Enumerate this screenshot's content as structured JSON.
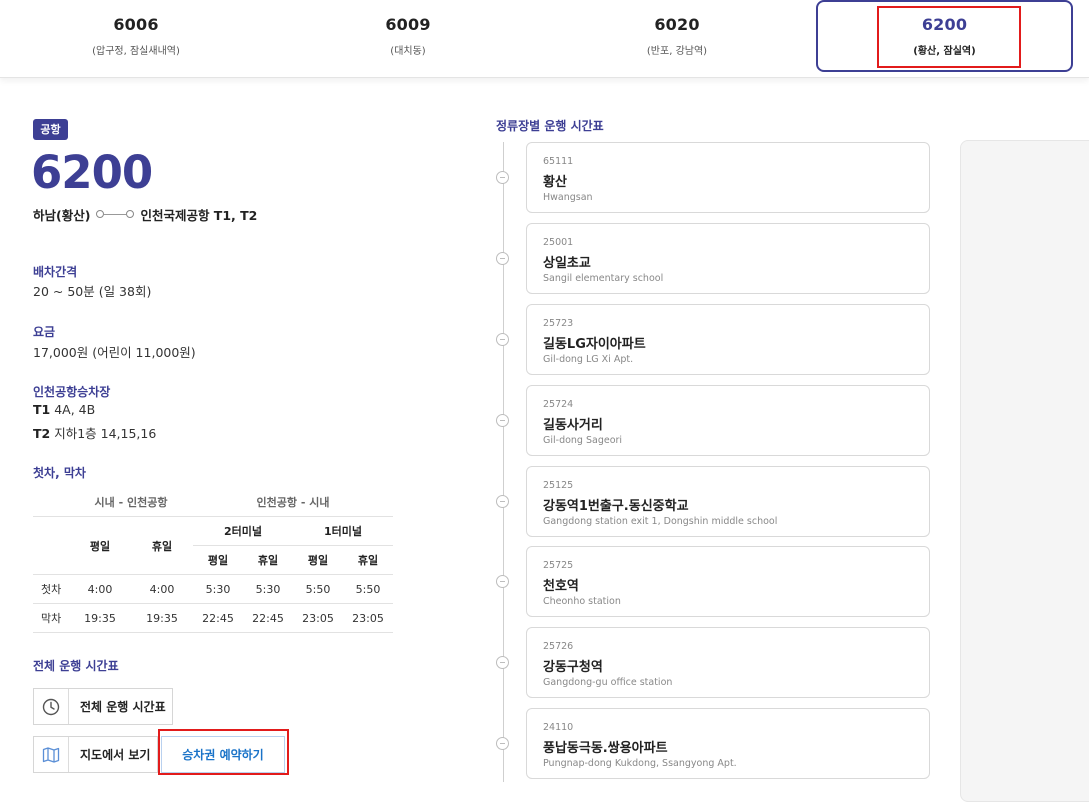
{
  "tabs": [
    {
      "number": "6006",
      "sub": "(압구정, 잠실새내역)"
    },
    {
      "number": "6009",
      "sub": "(대치동)"
    },
    {
      "number": "6020",
      "sub": "(반포, 강남역)"
    },
    {
      "number": "6200",
      "sub": "(황산, 잠실역)"
    }
  ],
  "route": {
    "badge": "공항",
    "number": "6200",
    "from": "하남(황산)",
    "to": "인천국제공항 T1, T2"
  },
  "interval": {
    "title": "배차간격",
    "value": "20 ~ 50분 (일 38회)"
  },
  "fare": {
    "title": "요금",
    "value": "17,000원 (어린이 11,000원)"
  },
  "airport_stops": {
    "title": "인천공항승차장",
    "t1_label": "T1",
    "t1_value": "4A, 4B",
    "t2_label": "T2",
    "t2_value": "지하1층 14,15,16"
  },
  "first_last": {
    "title": "첫차, 막차",
    "header_city_to_airport": "시내 - 인천공항",
    "header_airport_to_city": "인천공항 - 시내",
    "terminal2": "2터미널",
    "terminal1": "1터미널",
    "weekday": "평일",
    "holiday": "휴일",
    "rows": [
      {
        "label": "첫차",
        "values": [
          "4:00",
          "4:00",
          "5:30",
          "5:30",
          "5:50",
          "5:50"
        ]
      },
      {
        "label": "막차",
        "values": [
          "19:35",
          "19:35",
          "22:45",
          "22:45",
          "23:05",
          "23:05"
        ]
      }
    ]
  },
  "full_schedule": {
    "title": "전체 운행 시간표",
    "button_label": "전체 운행 시간표",
    "map_button_label": "지도에서 보기",
    "reserve_button_label": "승차권 예약하기"
  },
  "timeline": {
    "title": "정류장별 운행 시간표",
    "stops": [
      {
        "id": "65111",
        "name": "황산",
        "name_en": "Hwangsan"
      },
      {
        "id": "25001",
        "name": "상일초교",
        "name_en": "Sangil elementary school"
      },
      {
        "id": "25723",
        "name": "길동LG자이아파트",
        "name_en": "Gil-dong LG Xi Apt."
      },
      {
        "id": "25724",
        "name": "길동사거리",
        "name_en": "Gil-dong Sageori"
      },
      {
        "id": "25125",
        "name": "강동역1번출구.동신중학교",
        "name_en": "Gangdong station exit 1, Dongshin middle school"
      },
      {
        "id": "25725",
        "name": "천호역",
        "name_en": "Cheonho station"
      },
      {
        "id": "25726",
        "name": "강동구청역",
        "name_en": "Gangdong-gu office station"
      },
      {
        "id": "24110",
        "name": "풍납동극동.쌍용아파트",
        "name_en": "Pungnap-dong Kukdong, Ssangyong Apt."
      }
    ]
  },
  "colors": {
    "brand": "#3d3f94",
    "highlight": "#e21b1b",
    "link": "#1a73c8"
  }
}
